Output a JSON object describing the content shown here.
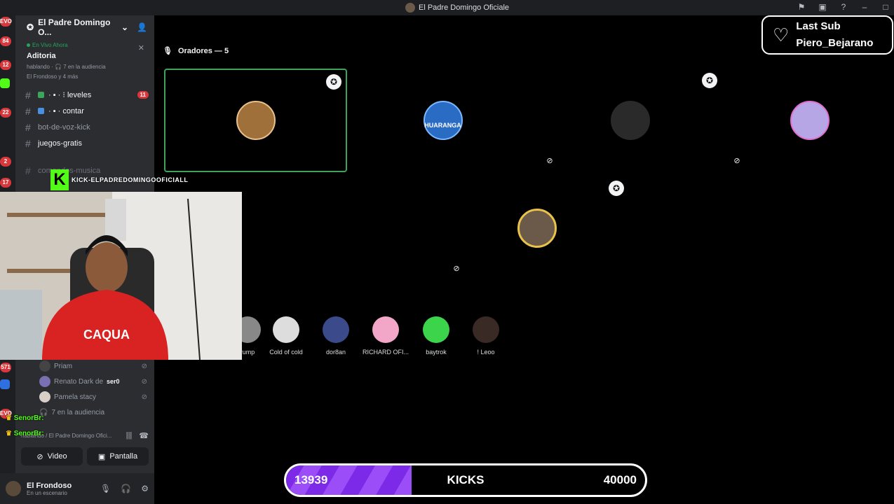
{
  "window": {
    "title": "El Padre Domingo Oficiale"
  },
  "guild": {
    "name": "El Padre Domingo O..."
  },
  "live": {
    "status": "En Vivo Ahora",
    "title": "Aditoria",
    "meta1": "hablando · 🎧 7 en la audiencia",
    "meta2": "El Frondoso y 4 más"
  },
  "channels": [
    {
      "label": "· ▪ · ⁝ leveles",
      "badge": "11"
    },
    {
      "label": "· ▪ · contar"
    },
    {
      "label": "bot-de-voz-kick"
    },
    {
      "label": "juegos-gratis"
    },
    {
      "label": "comandos-musica"
    }
  ],
  "voice_users": [
    {
      "name": "Priam"
    },
    {
      "name": "Renato Dark de",
      "tag": "ser0"
    },
    {
      "name": "Pamela stacy"
    },
    {
      "name": "7 en la audiencia"
    }
  ],
  "voice_panel": {
    "line": "hablando / El Padre Domingo Ofici...",
    "video": "Video",
    "screen": "Pantalla"
  },
  "user": {
    "name": "El Frondoso",
    "status": "En un escenario"
  },
  "stage": {
    "speakers_header": "Oradores — 5"
  },
  "audience": [
    {
      "name": "rump"
    },
    {
      "name": "Cold of cold"
    },
    {
      "name": "dor8an"
    },
    {
      "name": "RICHARD OFI..."
    },
    {
      "name": "baytrok"
    },
    {
      "name": "! Leoo"
    }
  ],
  "tiles": [
    {
      "color": "#5a3a14",
      "label": ""
    },
    {
      "color": "#0a0d5c",
      "label": "HUARANGA"
    },
    {
      "color": "#7b7b7b",
      "label": ""
    },
    {
      "color": "#8f86d1",
      "label": ""
    },
    {
      "color": "#4a3b28",
      "label": ""
    }
  ],
  "overlay": {
    "last_sub_title": "Last Sub",
    "last_sub_name": "Piero_Bejarano",
    "kick_tag": "KICK-ELPADREDOMINGOOFICIALL",
    "chat1": "SenorBr:",
    "chat2": "SenorBr:"
  },
  "kicks": {
    "current": "13939",
    "label": "KICKS",
    "goal": "40000",
    "progress": 0.35
  },
  "rail_badges": [
    "EVO",
    "84",
    "12",
    "22",
    "2",
    "17",
    "571",
    "EVO"
  ]
}
